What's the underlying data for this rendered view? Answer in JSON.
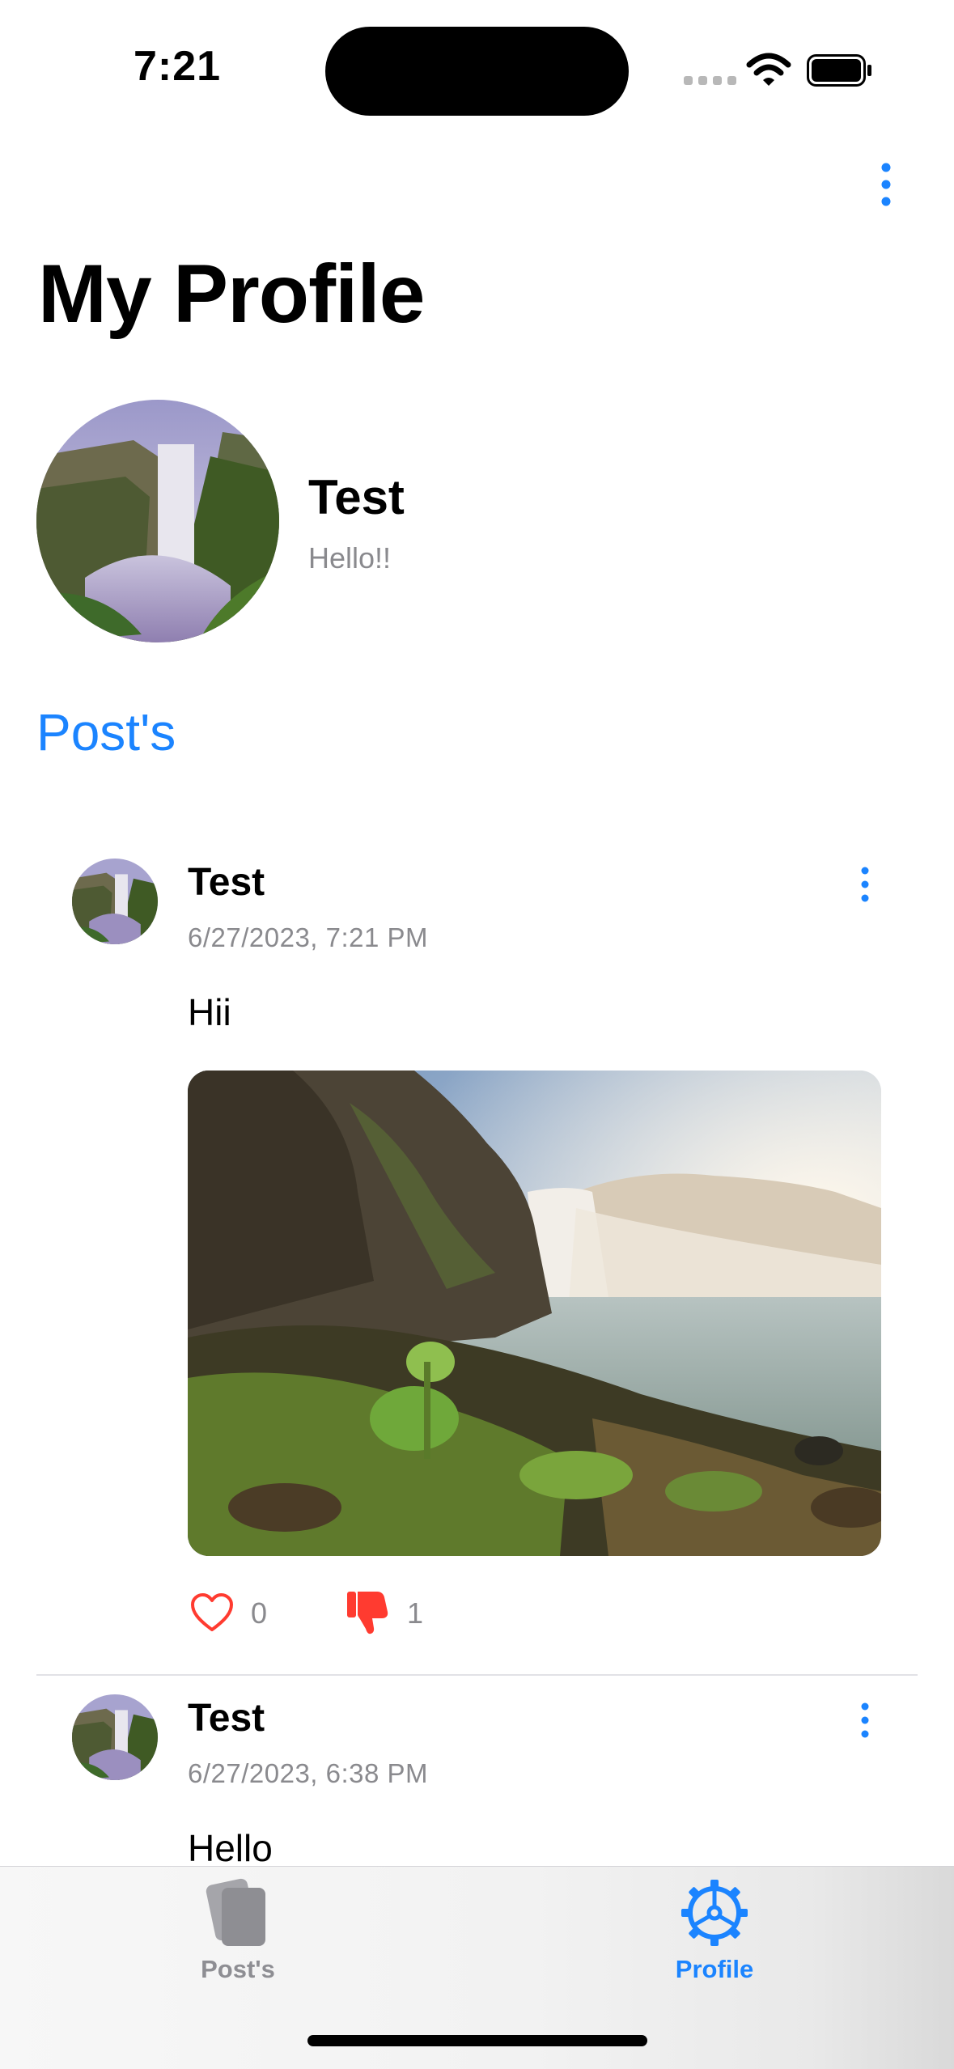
{
  "status_bar": {
    "time": "7:21"
  },
  "header": {
    "title": "My Profile"
  },
  "profile": {
    "name": "Test",
    "bio": "Hello!!"
  },
  "section": {
    "title": "Post's"
  },
  "posts": [
    {
      "author": "Test",
      "date": "6/27/2023, 7:21 PM",
      "text": "Hii",
      "likes": "0",
      "dislikes": "1"
    },
    {
      "author": "Test",
      "date": "6/27/2023, 6:38 PM",
      "text": "Hello"
    }
  ],
  "tab_bar": {
    "tabs": [
      {
        "label": "Post's",
        "icon": "stacked-cards-icon",
        "selected": false
      },
      {
        "label": "Profile",
        "icon": "gear-icon",
        "selected": true
      }
    ]
  },
  "colors": {
    "accent": "#1b84ff",
    "secondary_text": "#8a8a8e",
    "like_red": "#ff3b30"
  }
}
